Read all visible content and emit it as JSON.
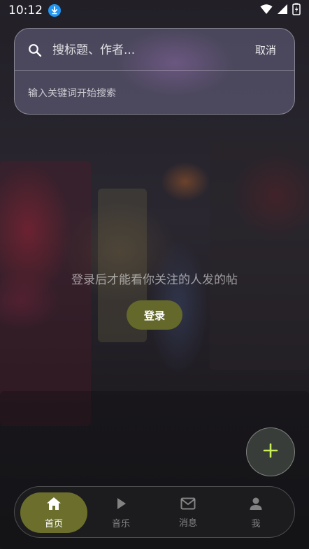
{
  "status_bar": {
    "time": "10:12"
  },
  "search": {
    "placeholder": "搜标题、作者...",
    "cancel_label": "取消",
    "hint": "输入关键词开始搜索"
  },
  "main": {
    "empty_message": "登录后才能看你关注的人发的帖",
    "login_label": "登录"
  },
  "bottom_nav": {
    "items": [
      {
        "label": "首页",
        "icon": "home-icon",
        "active": true
      },
      {
        "label": "音乐",
        "icon": "play-icon",
        "active": false
      },
      {
        "label": "消息",
        "icon": "mail-icon",
        "active": false
      },
      {
        "label": "我",
        "icon": "person-icon",
        "active": false
      }
    ]
  },
  "colors": {
    "accent": "#6b6f2b",
    "fab_plus": "#c8ee5a",
    "download_badge": "#2196f3"
  }
}
